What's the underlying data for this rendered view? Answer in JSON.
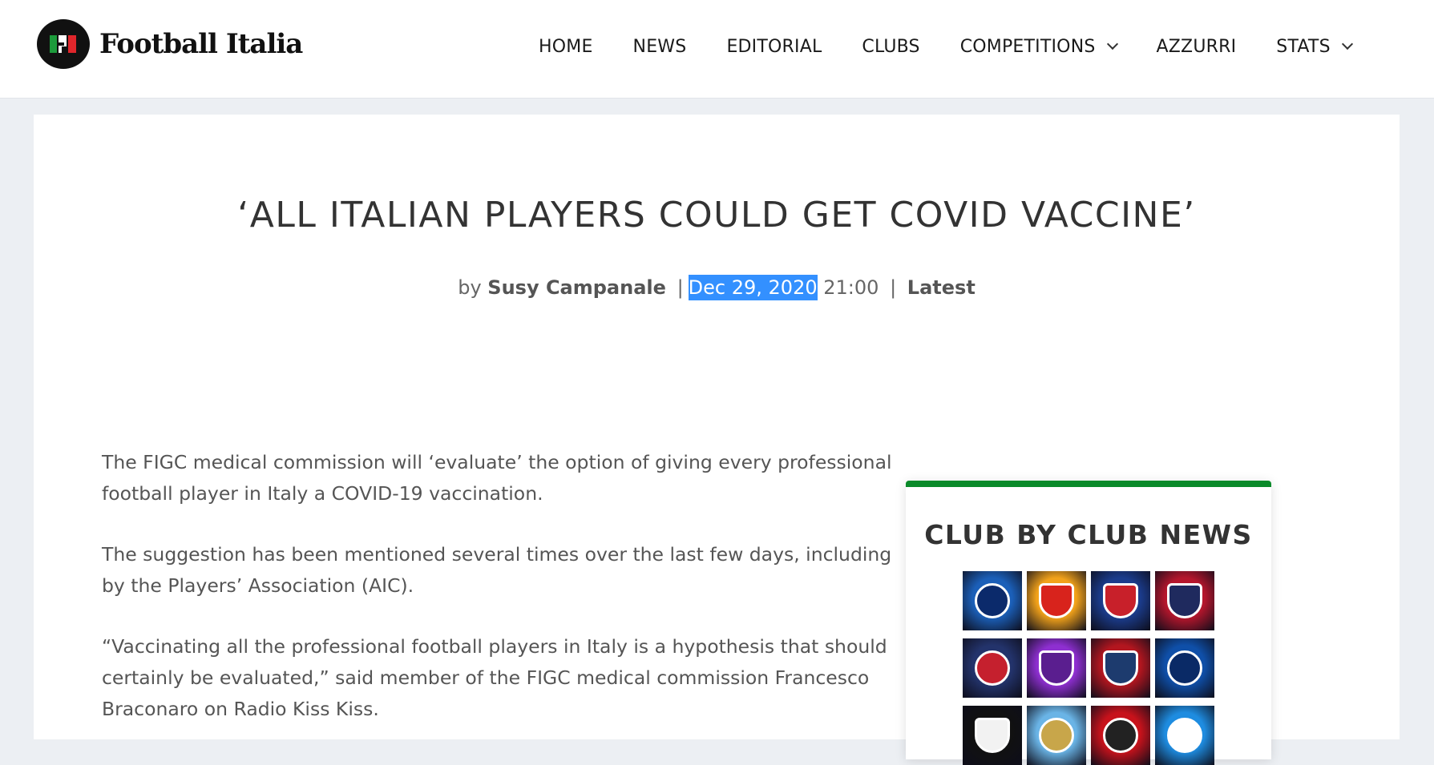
{
  "site": {
    "name": "Football Italia",
    "colors": {
      "green": "#1c9b3b",
      "red": "#e0262b",
      "accent": "#0a8a2a",
      "highlight": "#3390ff"
    }
  },
  "nav": {
    "items": [
      {
        "label": "HOME",
        "dropdown": false
      },
      {
        "label": "NEWS",
        "dropdown": false
      },
      {
        "label": "EDITORIAL",
        "dropdown": false
      },
      {
        "label": "CLUBS",
        "dropdown": false
      },
      {
        "label": "COMPETITIONS",
        "dropdown": true
      },
      {
        "label": "AZZURRI",
        "dropdown": false
      },
      {
        "label": "STATS",
        "dropdown": true
      }
    ]
  },
  "article": {
    "title": "‘ALL ITALIAN PLAYERS COULD GET COVID VACCINE’",
    "meta": {
      "by": "by",
      "author": "Susy Campanale",
      "separator": "|",
      "date": "Dec 29, 2020",
      "time": "21:00",
      "category": "Latest"
    },
    "paragraphs": [
      "The FIGC medical commission will ‘evaluate’ the option of giving every professional football player in Italy a COVID-19 vaccination.",
      "The suggestion has been mentioned several times over the last few days, including by the Players’ Association (AIC).",
      "“Vaccinating all the professional football players in Italy is a hypothesis that should certainly be evaluated,” said member of the FIGC medical commission Francesco Braconaro on Radio Kiss Kiss."
    ]
  },
  "sidebar": {
    "widget_title": "CLUB BY CLUB NEWS",
    "clubs": [
      {
        "icon": "atalanta-crest-icon",
        "bg": "#1b5fb8",
        "crest": "#0b2a6b",
        "shape": "round"
      },
      {
        "icon": "benevento-crest-icon",
        "bg": "#f2a21a",
        "crest": "#d8231c",
        "shape": "shield"
      },
      {
        "icon": "bologna-crest-icon",
        "bg": "#1b3c8c",
        "crest": "#c8202a",
        "shape": "shield"
      },
      {
        "icon": "cagliari-crest-icon",
        "bg": "#b5162c",
        "crest": "#1f2a5e",
        "shape": "shield"
      },
      {
        "icon": "crotone-crest-icon",
        "bg": "#23336b",
        "crest": "#c5202e",
        "shape": "round"
      },
      {
        "icon": "fiorentina-crest-icon",
        "bg": "#8e2fd0",
        "crest": "#5a1e8f",
        "shape": "shield"
      },
      {
        "icon": "genoa-crest-icon",
        "bg": "#b3161f",
        "crest": "#1d3b6e",
        "shape": "shield"
      },
      {
        "icon": "inter-crest-icon",
        "bg": "#0f4fa8",
        "crest": "#0a2a66",
        "shape": "round"
      },
      {
        "icon": "juventus-crest-icon",
        "bg": "#111111",
        "crest": "#f2f2f2",
        "shape": "shield"
      },
      {
        "icon": "lazio-crest-icon",
        "bg": "#6ab4e6",
        "crest": "#c8a64a",
        "shape": "round"
      },
      {
        "icon": "milan-crest-icon",
        "bg": "#c7121b",
        "crest": "#222222",
        "shape": "round"
      },
      {
        "icon": "napoli-crest-icon",
        "bg": "#1e8ce0",
        "crest": "#ffffff",
        "shape": "round"
      }
    ]
  }
}
